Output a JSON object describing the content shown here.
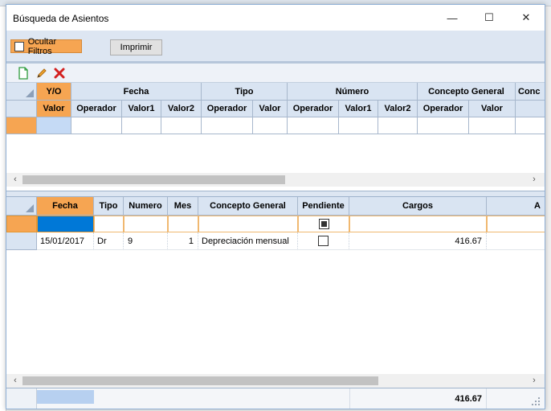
{
  "window": {
    "title": "Búsqueda de Asientos",
    "minimize_glyph": "—",
    "maximize_glyph": "☐",
    "close_glyph": "✕"
  },
  "filters": {
    "hide_filters_label": "Ocultar Filtros",
    "print_button": "Imprimir"
  },
  "toolbar": {
    "icons": [
      "new-document-icon",
      "edit-pencil-icon",
      "delete-x-icon"
    ]
  },
  "filter_grid": {
    "groups": [
      "Y/O",
      "Fecha",
      "Tipo",
      "Número",
      "Concepto General",
      "Conc"
    ],
    "subheaders": [
      "Valor",
      "Operador",
      "Valor1",
      "Valor2",
      "Operador",
      "Valor",
      "Operador",
      "Valor1",
      "Valor2",
      "Operador",
      "Valor"
    ]
  },
  "results_grid": {
    "headers": [
      "Fecha",
      "Tipo",
      "Numero",
      "Mes",
      "Concepto General",
      "Pendiente",
      "Cargos",
      "A"
    ],
    "rows": [
      {
        "fecha": "15/01/2017",
        "tipo": "Dr",
        "numero": "9",
        "mes": "1",
        "concepto": "Depreciación mensual",
        "pendiente": false,
        "cargos": "416.67"
      }
    ],
    "total_cargos": "416.67"
  },
  "colors": {
    "accent_orange": "#f6a552",
    "header_blue": "#d9e4f2",
    "selection_blue": "#0078d7"
  }
}
